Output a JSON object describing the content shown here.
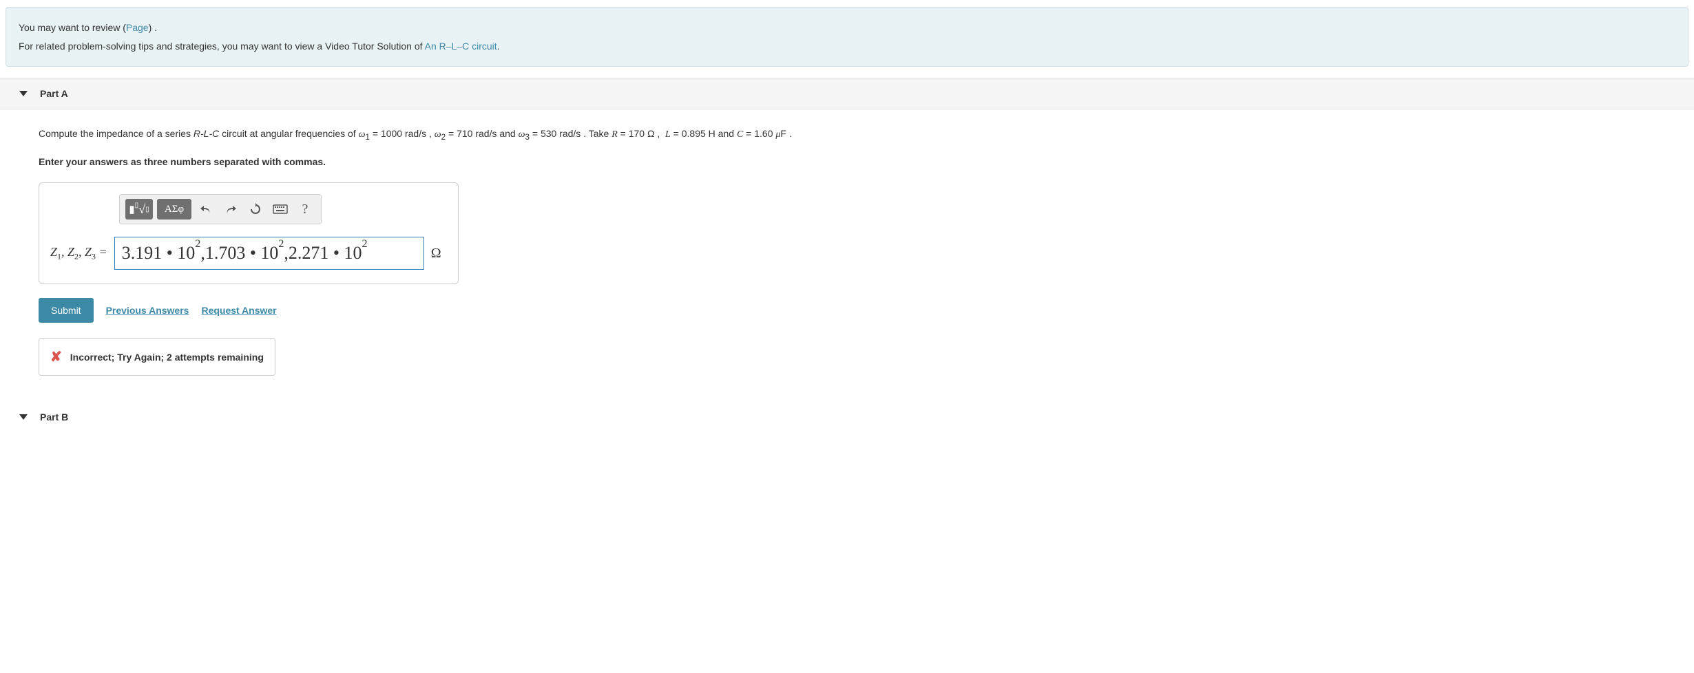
{
  "review": {
    "line1_pre": "You may want to review (",
    "line1_link": "Page",
    "line1_post": ") .",
    "line2_pre": "For related problem-solving tips and strategies, you may want to view a Video Tutor Solution of ",
    "line2_link": "An R–L–C circuit",
    "line2_post": "."
  },
  "partA": {
    "title": "Part A",
    "question_html": "Compute the impedance of a series <i>R-L-C</i> circuit at angular frequencies of <span class='math'>ω</span><sub>1</sub> = 1000 rad/s , <span class='math'>ω</span><sub>2</sub> = 710 rad/s and <span class='math'>ω</span><sub>3</sub> = 530 rad/s . Take <span class='math'>R</span> = 170 Ω ,&nbsp; <span class='math'>L</span> = 0.895 H and <span class='math'>C</span> = 1.60 <span class='math'>μ</span>F .",
    "instruction": "Enter your answers as three numbers separated with commas.",
    "var_label_html": "<i>Z</i><sub>1</sub>, <i>Z</i><sub>2</sub>, <i>Z</i><sub>3</sub> =",
    "input_value_html": "3.191 • 10<sup>2</sup>,1.703 • 10<sup>2</sup>,2.271 • 10<sup>2</sup>",
    "unit": "Ω",
    "submit": "Submit",
    "prev_answers": "Previous Answers",
    "request_answer": "Request Answer",
    "feedback": "Incorrect; Try Again; 2 attempts remaining"
  },
  "toolbar": {
    "symbols": "ΑΣφ",
    "help": "?"
  },
  "partB": {
    "title": "Part B"
  }
}
